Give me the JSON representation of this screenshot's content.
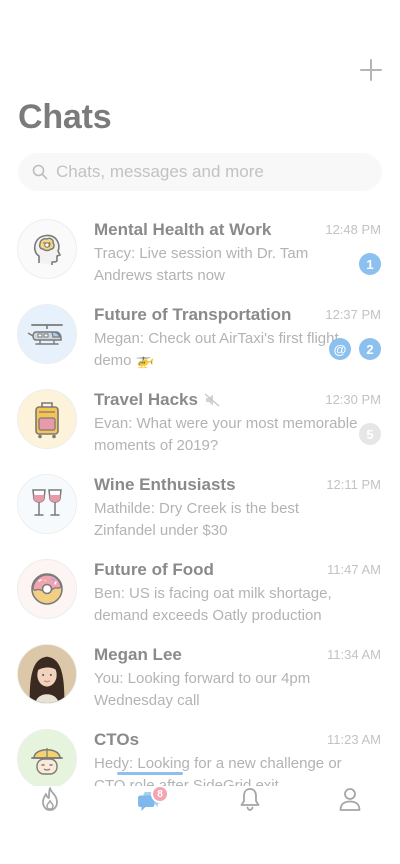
{
  "header": {
    "add_label": "+",
    "title": "Chats"
  },
  "search": {
    "placeholder": "Chats, messages and more"
  },
  "chats": [
    {
      "name": "Mental Health at Work",
      "time": "12:48 PM",
      "preview": "Tracy: Live session with Dr. Tam Andrews starts now",
      "unread": "1",
      "icon": "brain-head-icon"
    },
    {
      "name": "Future of Transportation",
      "time": "12:37 PM",
      "preview": "Megan: Check out AirTaxi's first flight demo 🚁",
      "mention": "@",
      "unread": "2",
      "icon": "helicopter-icon"
    },
    {
      "name": "Travel Hacks",
      "time": "12:30 PM",
      "preview": "Evan: What were your most memorable moments of 2019?",
      "unread": "5",
      "muted": true,
      "icon": "suitcase-icon"
    },
    {
      "name": "Wine Enthusiasts",
      "time": "12:11 PM",
      "preview": "Mathilde: Dry Creek is the best Zinfandel under $30",
      "icon": "wine-glasses-icon"
    },
    {
      "name": "Future of Food",
      "time": "11:47 AM",
      "preview": "Ben: US is facing oat milk shortage, demand exceeds Oatly production",
      "icon": "donut-icon"
    },
    {
      "name": "Megan Lee",
      "time": "11:34 AM",
      "preview": "You: Looking forward to our 4pm Wednesday call",
      "icon": "person-photo-icon"
    },
    {
      "name": "CTOs",
      "time": "11:23 AM",
      "preview": "Hedy: Looking for a new challenge or CTO role after SideGrid exit",
      "icon": "engineer-icon"
    }
  ],
  "tabbar": {
    "tabs": [
      "flame-icon",
      "chat-bubbles-icon",
      "bell-icon",
      "profile-icon"
    ],
    "chats_badge": "8",
    "accent": "#8cc0ef"
  }
}
